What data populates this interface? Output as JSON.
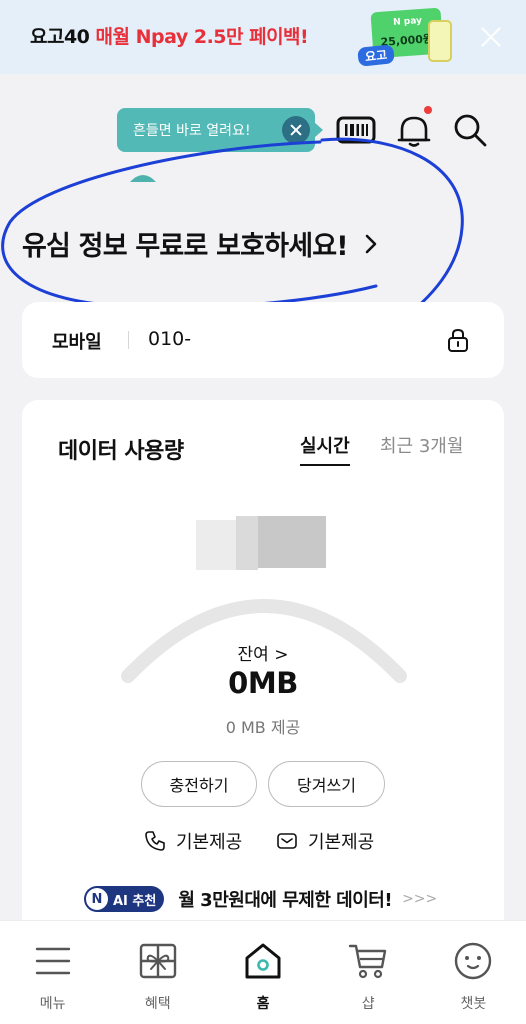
{
  "promo": {
    "brand": "요고40",
    "highlight": "매월 Npay 2.5만 페이백!",
    "card_label": "N pay",
    "card_amount": "25,000원",
    "logo_text": "요고"
  },
  "tooltip": {
    "text": "흔들면 바로 열려요!"
  },
  "hero": {
    "title": "유심 정보 무료로 보호하세요!"
  },
  "line_card": {
    "label": "모바일",
    "number": "010-"
  },
  "data_card": {
    "title": "데이터 사용량",
    "tabs": [
      "실시간",
      "최근 3개월"
    ],
    "remain_label": "잔여 >",
    "remain_value": "0MB",
    "provided": "0 MB 제공",
    "buttons": [
      "충전하기",
      "당겨쓰기"
    ],
    "call_allowance": "기본제공",
    "sms_allowance": "기본제공"
  },
  "ai": {
    "badge_n": "N",
    "badge_text": "AI 추천",
    "text": "월 3만원대에 무제한 데이터!",
    "more": ">>>"
  },
  "nav": {
    "items": [
      {
        "label": "메뉴",
        "icon": "menu-icon"
      },
      {
        "label": "혜택",
        "icon": "gift-icon"
      },
      {
        "label": "홈",
        "icon": "home-icon"
      },
      {
        "label": "샵",
        "icon": "cart-icon"
      },
      {
        "label": "챗봇",
        "icon": "chatbot-icon"
      }
    ],
    "active_index": 2
  },
  "colors": {
    "accent_teal": "#53b9b6",
    "promo_red": "#e8303a",
    "ai_badge": "#1e3580",
    "annotation_ink": "#1c3fd6"
  }
}
